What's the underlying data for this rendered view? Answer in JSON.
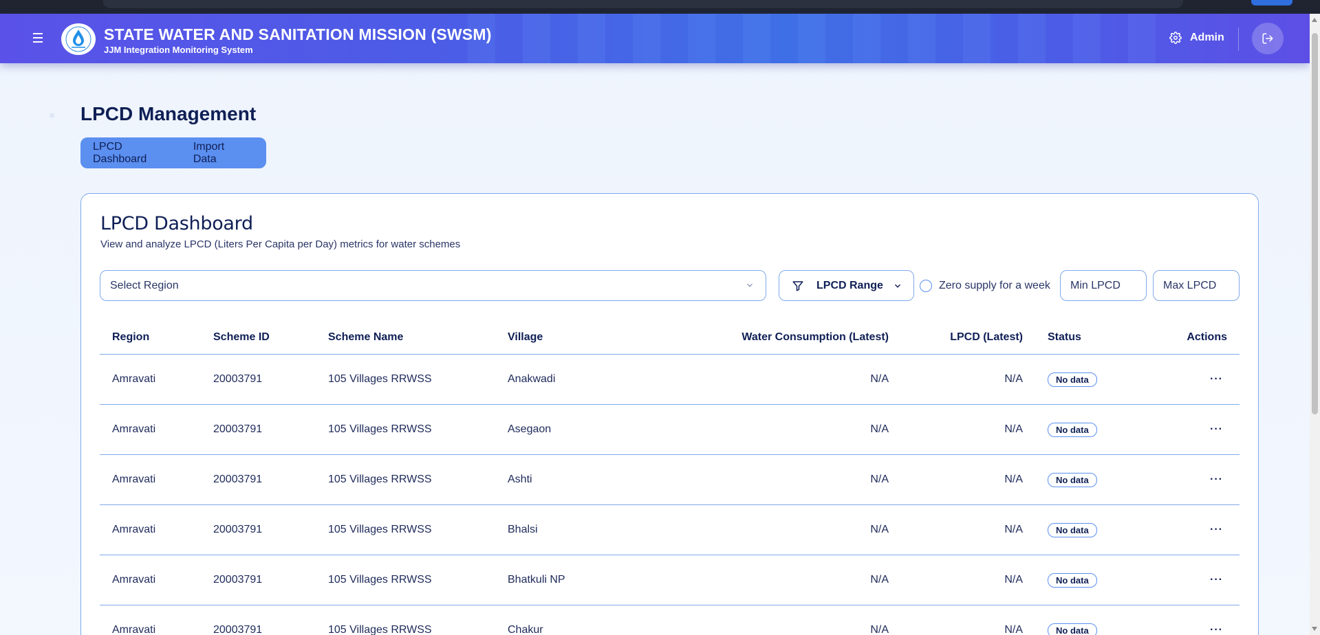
{
  "header": {
    "title": "STATE WATER AND SANITATION MISSION (SWSM)",
    "subtitle": "JJM Integration Monitoring System",
    "user_label": "Admin"
  },
  "page": {
    "title": "LPCD Management",
    "tabs": [
      {
        "label": "LPCD Dashboard"
      },
      {
        "label": "Import Data"
      }
    ]
  },
  "dashboard": {
    "title": "LPCD Dashboard",
    "description": "View and analyze LPCD (Liters Per Capita per Day) metrics for water schemes",
    "filters": {
      "region_placeholder": "Select Region",
      "lpcd_range_label": "LPCD Range",
      "zero_supply_label": "Zero supply for a week",
      "min_placeholder": "Min LPCD",
      "max_placeholder": "Max LPCD"
    },
    "table": {
      "headers": {
        "region": "Region",
        "scheme_id": "Scheme ID",
        "scheme_name": "Scheme Name",
        "village": "Village",
        "water": "Water Consumption (Latest)",
        "lpcd": "LPCD (Latest)",
        "status": "Status",
        "actions": "Actions"
      },
      "rows": [
        {
          "region": "Amravati",
          "scheme_id": "20003791",
          "scheme_name": "105 Villages RRWSS",
          "village": "Anakwadi",
          "water": "N/A",
          "lpcd": "N/A",
          "status": "No data",
          "actions": "···"
        },
        {
          "region": "Amravati",
          "scheme_id": "20003791",
          "scheme_name": "105 Villages RRWSS",
          "village": "Asegaon",
          "water": "N/A",
          "lpcd": "N/A",
          "status": "No data",
          "actions": "···"
        },
        {
          "region": "Amravati",
          "scheme_id": "20003791",
          "scheme_name": "105 Villages RRWSS",
          "village": "Ashti",
          "water": "N/A",
          "lpcd": "N/A",
          "status": "No data",
          "actions": "···"
        },
        {
          "region": "Amravati",
          "scheme_id": "20003791",
          "scheme_name": "105 Villages RRWSS",
          "village": "Bhalsi",
          "water": "N/A",
          "lpcd": "N/A",
          "status": "No data",
          "actions": "···"
        },
        {
          "region": "Amravati",
          "scheme_id": "20003791",
          "scheme_name": "105 Villages RRWSS",
          "village": "Bhatkuli NP",
          "water": "N/A",
          "lpcd": "N/A",
          "status": "No data",
          "actions": "···"
        },
        {
          "region": "Amravati",
          "scheme_id": "20003791",
          "scheme_name": "105 Villages RRWSS",
          "village": "Chakur",
          "water": "N/A",
          "lpcd": "N/A",
          "status": "No data",
          "actions": "···"
        }
      ]
    }
  },
  "colors": {
    "header_gradient_start": "#5a52e8",
    "header_gradient_mid": "#3f6fe6",
    "tab_bg": "#5b8ff0",
    "border": "#7fa9ea",
    "text_dark": "#0f1f55"
  }
}
